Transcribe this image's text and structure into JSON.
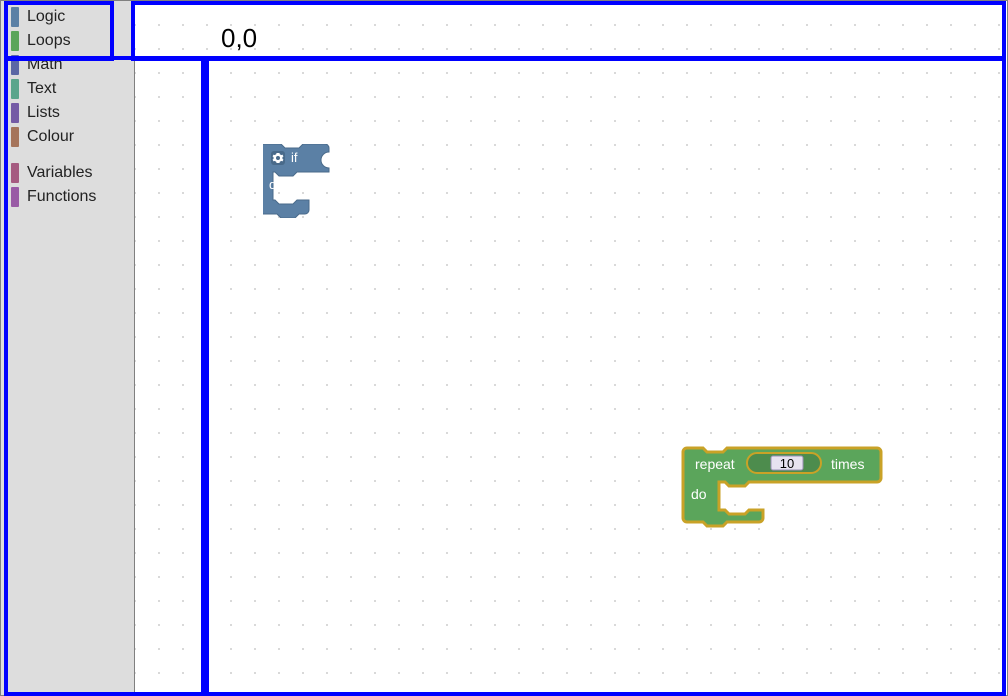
{
  "toolbox": {
    "groups": [
      [
        {
          "label": "Logic",
          "color": "#5b80a5"
        },
        {
          "label": "Loops",
          "color": "#5ba55b"
        },
        {
          "label": "Math",
          "color": "#5b67a5"
        },
        {
          "label": "Text",
          "color": "#5ba58c"
        },
        {
          "label": "Lists",
          "color": "#745ba5"
        },
        {
          "label": "Colour",
          "color": "#a5745b"
        }
      ],
      [
        {
          "label": "Variables",
          "color": "#a55b80"
        },
        {
          "label": "Functions",
          "color": "#995ba5"
        }
      ]
    ]
  },
  "overlay": {
    "coord_label": "0,0"
  },
  "blocks": {
    "if": {
      "if_label": "if",
      "do_label": "do",
      "gear_icon": "gear-icon",
      "color_fill": "#5b80a5",
      "color_stroke": "#496a8a"
    },
    "repeat": {
      "repeat_label": "repeat",
      "times_label": "times",
      "do_label": "do",
      "count_value": "10",
      "color_fill": "#5ba55b",
      "color_stroke": "#c9a227",
      "field_bg": "#e7e2f0",
      "field_border": "#9a8fb5"
    }
  }
}
